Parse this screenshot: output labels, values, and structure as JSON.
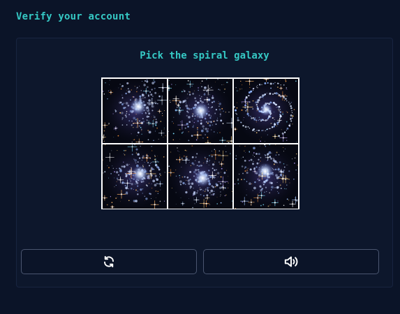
{
  "header": {
    "title": "Verify your account"
  },
  "challenge": {
    "prompt": "Pick the spiral galaxy",
    "tiles": [
      {
        "label": "galaxy-1",
        "type": "irregular"
      },
      {
        "label": "galaxy-2",
        "type": "irregular"
      },
      {
        "label": "galaxy-3",
        "type": "spiral"
      },
      {
        "label": "galaxy-4",
        "type": "irregular"
      },
      {
        "label": "galaxy-5",
        "type": "irregular"
      },
      {
        "label": "galaxy-6",
        "type": "irregular"
      }
    ]
  },
  "controls": {
    "refresh_icon": "refresh-icon",
    "audio_icon": "speaker-icon"
  },
  "colors": {
    "background": "#0b1428",
    "accent": "#35c8c4",
    "button_border": "#4b5670"
  }
}
